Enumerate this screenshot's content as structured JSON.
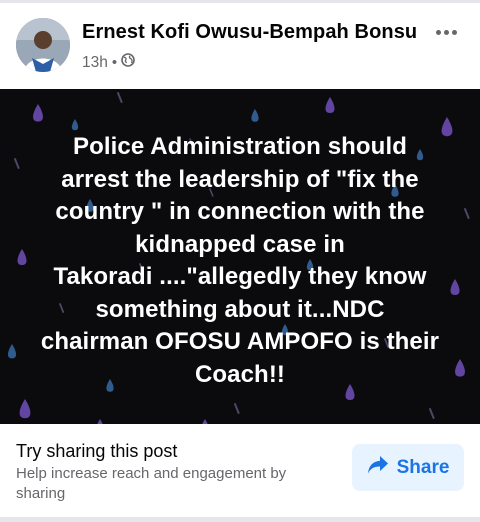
{
  "post": {
    "author_name": "Ernest Kofi Owusu-Bempah Bonsu",
    "timestamp": "13h",
    "separator": "•",
    "audience_icon": "globe-icon",
    "more_icon": "more-options-icon",
    "body_lines": [
      "Police Administration should",
      "arrest the leadership of \"fix the",
      "country \" in connection with the",
      "kidnapped case in",
      "Takoradi ....\"allegedly they know",
      "something about it...NDC",
      "chairman OFOSU AMPOFO is their",
      "Coach!!"
    ],
    "background_color": "#0b0b0d",
    "raindrop_color": "#6b4bb0"
  },
  "footer": {
    "title": "Try sharing this post",
    "description": "Help increase reach and engagement by sharing",
    "share_label": "Share",
    "share_icon": "share-arrow-icon",
    "accent": "#1b74e4",
    "button_bg": "#e7f3ff"
  }
}
